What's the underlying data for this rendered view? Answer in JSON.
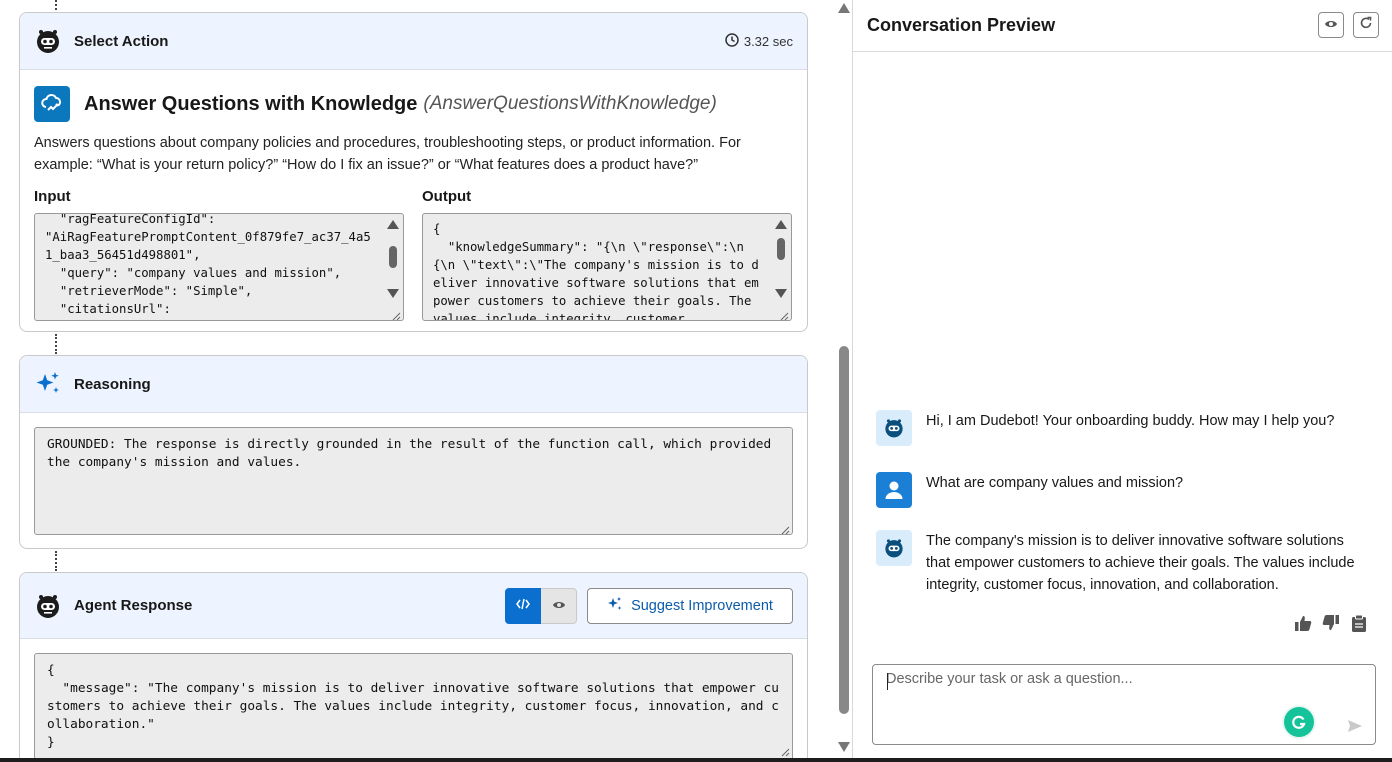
{
  "select_action": {
    "title": "Select Action",
    "duration": "3.32 sec"
  },
  "action": {
    "name": "Answer Questions with Knowledge",
    "api_name": "(AnswerQuestionsWithKnowledge)",
    "description": "Answers questions about company policies and procedures, troubleshooting steps, or product information. For example: “What is your return policy?” “How do I fix an issue?” or “What features does a product have?”",
    "input_label": "Input",
    "output_label": "Output",
    "input_text": "  \"ragFeatureConfigId\":\n\"AiRagFeaturePromptContent_0f879fe7_ac37_4a51_baa3_56451d498801\",\n  \"query\": \"company values and mission\",\n  \"retrieverMode\": \"Simple\",\n  \"citationsUrl\":",
    "output_text": "{\n  \"knowledgeSummary\": \"{\\n \\\"response\\\":\\n{\\n \\\"text\\\":\\\"The company's mission is to deliver innovative software solutions that empower customers to achieve their goals. The values include integrity, customer"
  },
  "reasoning": {
    "title": "Reasoning",
    "text": "GROUNDED: The response is directly grounded in the result of the function call, which provided the company's mission and values."
  },
  "agent_response": {
    "title": "Agent Response",
    "suggest_label": "Suggest Improvement",
    "text": "{\n  \"message\": \"The company's mission is to deliver innovative software solutions that empower customers to achieve their goals. The values include integrity, customer focus, innovation, and collaboration.\"\n}"
  },
  "preview": {
    "title": "Conversation Preview",
    "messages": [
      {
        "role": "bot",
        "text": "Hi, I am Dudebot! Your onboarding buddy. How may I help you?"
      },
      {
        "role": "user",
        "text": "What are company values and mission?"
      },
      {
        "role": "bot",
        "text": "The company's mission is to deliver innovative software solutions that empower customers to achieve their goals. The values include integrity, customer focus, innovation, and collaboration."
      }
    ],
    "input_placeholder": "Describe your task or ask a question..."
  },
  "colors": {
    "brand_blue": "#0b6fd0",
    "header_tint": "#eef4ff",
    "action_icon": "#0b77bd"
  },
  "icons": [
    "bot-icon",
    "clock-icon",
    "knowledge-icon",
    "sparkle-icon",
    "code-icon",
    "eye-icon",
    "refresh-icon",
    "user-icon",
    "thumbs-up-icon",
    "thumbs-down-icon",
    "clipboard-icon",
    "grammarly-icon",
    "send-icon"
  ]
}
